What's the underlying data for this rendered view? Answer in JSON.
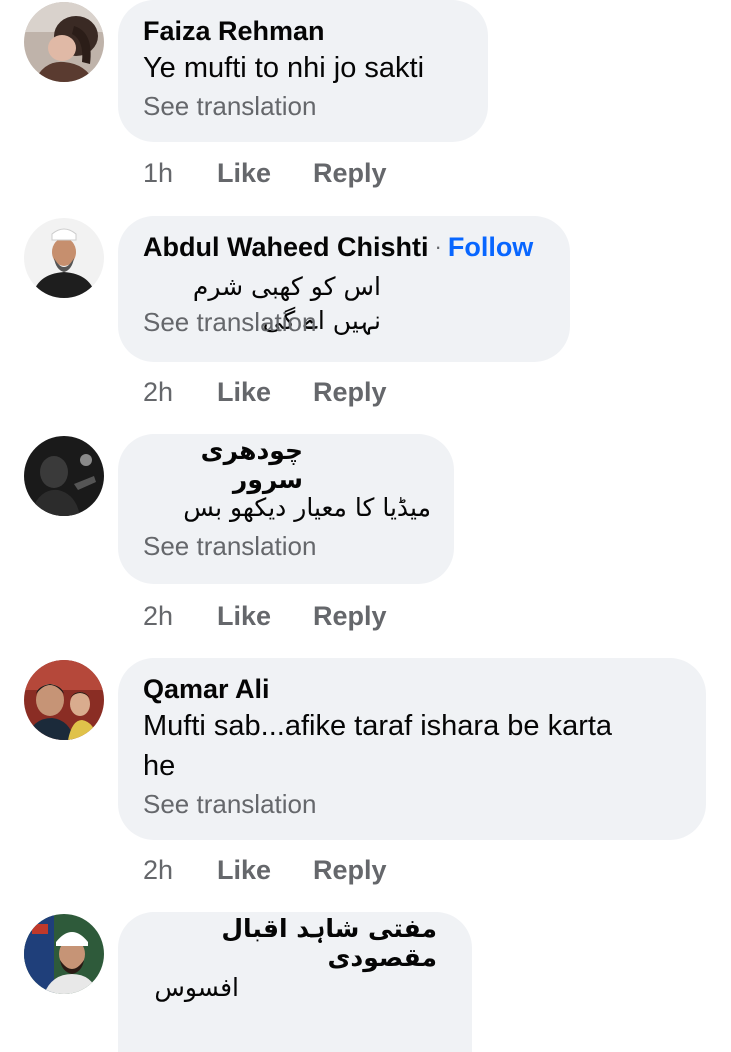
{
  "comments": [
    {
      "name": "Faiza Rehman",
      "text": "Ye mufti to nhi jo sakti",
      "see_translation": "See translation",
      "time": "1h",
      "like": "Like",
      "reply": "Reply"
    },
    {
      "name": "Abdul Waheed Chishti",
      "follow_separator": "·",
      "follow": "Follow",
      "text": "اس کو کھبی شرم نہیں اے گی",
      "see_translation": "See translation",
      "time": "2h",
      "like": "Like",
      "reply": "Reply"
    },
    {
      "name": "چودھری سرور",
      "text": "میڈیا کا معیار دیکھو بس",
      "see_translation": "See translation",
      "time": "2h",
      "like": "Like",
      "reply": "Reply"
    },
    {
      "name": "Qamar Ali",
      "text_line1": "Mufti sab...afike taraf ishara be karta",
      "text_line2": "he",
      "see_translation": "See translation",
      "time": "2h",
      "like": "Like",
      "reply": "Reply"
    },
    {
      "name": "مفتی شاہد اقبال مقصودی",
      "text": "افسوس"
    }
  ],
  "colors": {
    "bubble": "#f0f2f5",
    "name": "#050505",
    "secondary": "#65676b",
    "follow": "#0866ff"
  }
}
